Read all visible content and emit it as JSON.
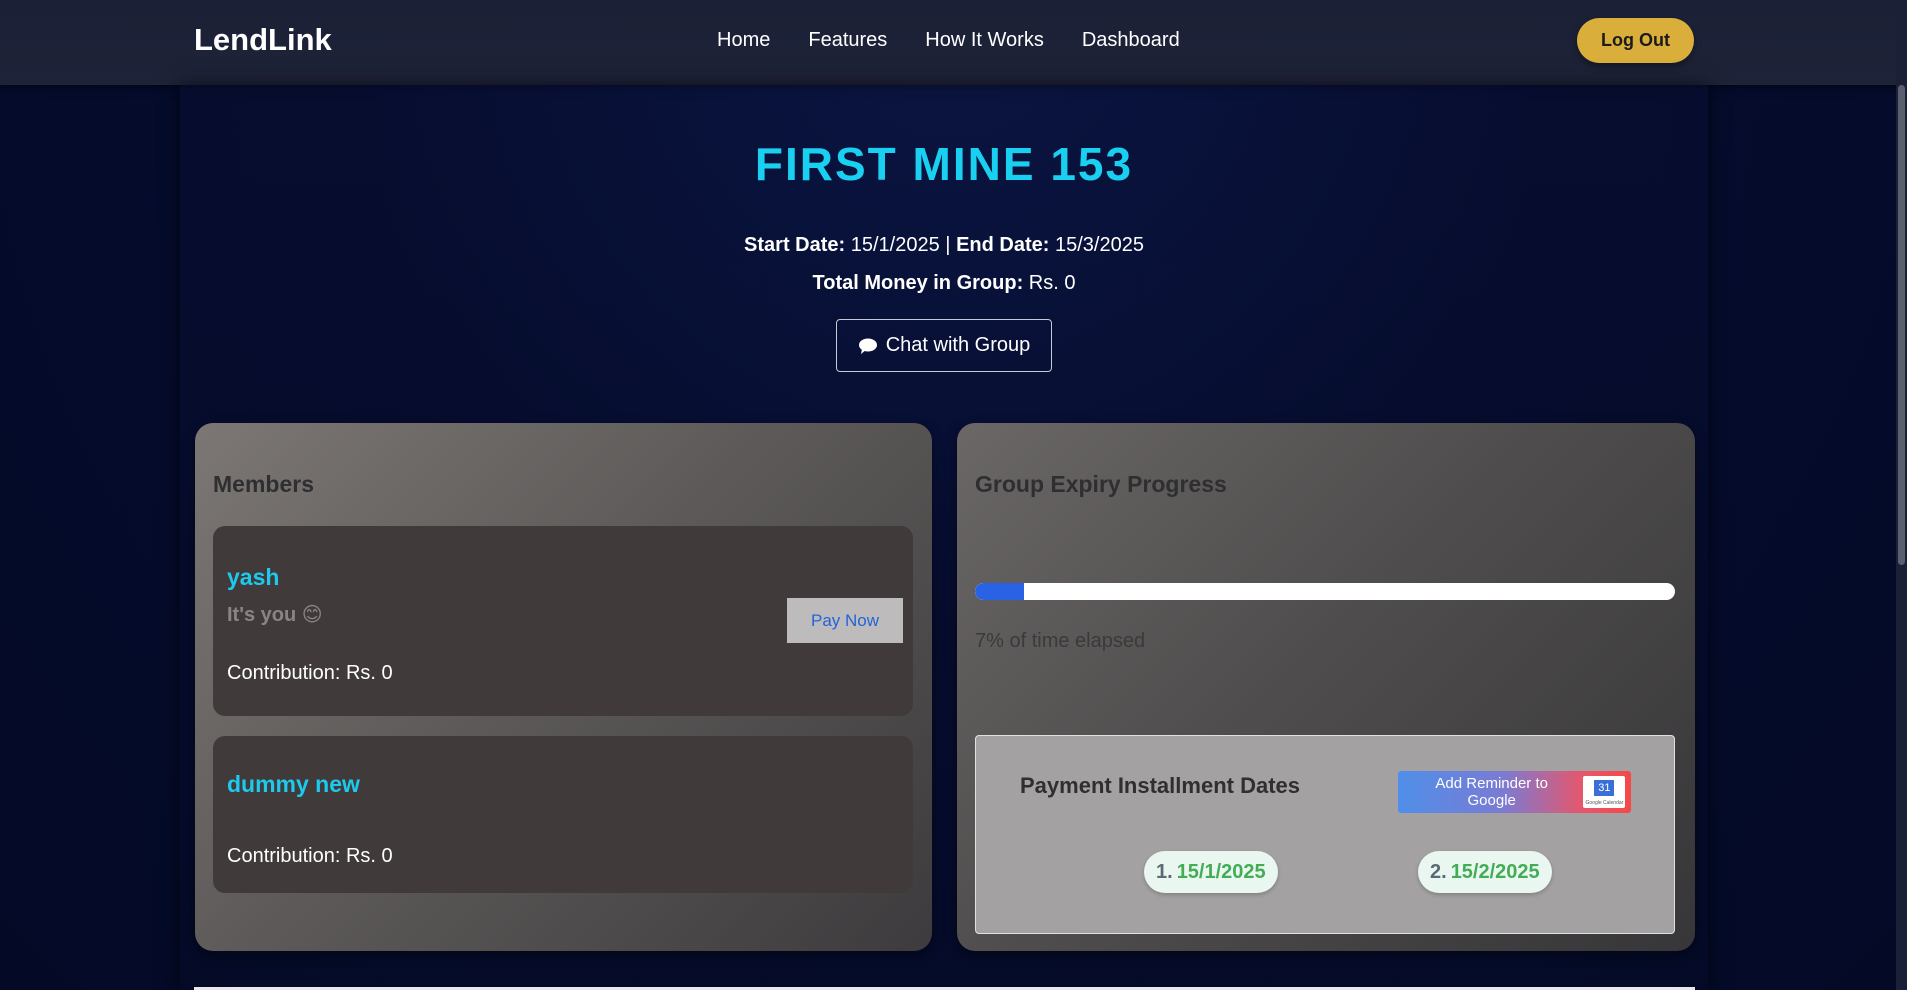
{
  "nav": {
    "brand": "LendLink",
    "links": [
      "Home",
      "Features",
      "How It Works",
      "Dashboard"
    ],
    "logout": "Log Out"
  },
  "group": {
    "title": "FIRST MINE 153",
    "start_label": "Start Date:",
    "start_value": "15/1/2025",
    "separator": "|",
    "end_label": "End Date:",
    "end_value": "15/3/2025",
    "total_label": "Total Money in Group:",
    "total_value": "Rs. 0",
    "chat_label": "Chat with Group"
  },
  "members": {
    "heading": "Members",
    "list": [
      {
        "name": "yash",
        "note": "It's you 😊",
        "contribution": "Contribution: Rs. 0",
        "action": "Pay Now"
      },
      {
        "name": "dummy new",
        "contribution": "Contribution: Rs. 0"
      }
    ]
  },
  "progress": {
    "heading": "Group Expiry Progress",
    "percent": 7,
    "text": "7% of time elapsed"
  },
  "installments": {
    "heading": "Payment Installment Dates",
    "reminder_label": "Add Reminder to Google",
    "cal_icon_day": "31",
    "cal_icon_caption": "Google Calendar",
    "dates": [
      {
        "num": "1.",
        "date": "15/1/2025"
      },
      {
        "num": "2.",
        "date": "15/2/2025"
      }
    ]
  },
  "colors": {
    "accent": "#19d0f0",
    "logout_bg": "#d9ae3a",
    "progress_fill": "#2a62e6",
    "date_green": "#42ad54"
  }
}
